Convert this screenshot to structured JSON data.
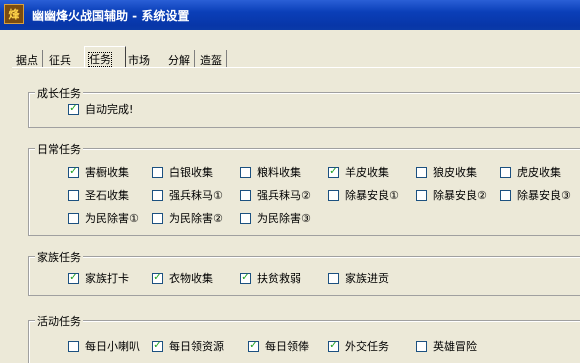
{
  "window": {
    "title": "幽幽烽火战国辅助  -  系统设置",
    "icon_glyph": "烽"
  },
  "tabs": [
    "据点",
    "征兵",
    "任务",
    "市场",
    "分解",
    "造盔"
  ],
  "groups": {
    "growth": {
      "title": "成长任务",
      "items": [
        {
          "label": "自动完成!",
          "checked": true
        }
      ]
    },
    "daily": {
      "title": "日常任务",
      "items": [
        {
          "label": "害橱收集",
          "checked": true
        },
        {
          "label": "白银收集",
          "checked": false
        },
        {
          "label": "粮料收集",
          "checked": false
        },
        {
          "label": "羊皮收集",
          "checked": true
        },
        {
          "label": "狼皮收集",
          "checked": false
        },
        {
          "label": "虎皮收集",
          "checked": false
        },
        {
          "label": "圣石收集",
          "checked": false
        },
        {
          "label": "强兵秣马①",
          "checked": false
        },
        {
          "label": "强兵秣马②",
          "checked": false
        },
        {
          "label": "除暴安良①",
          "checked": false
        },
        {
          "label": "除暴安良②",
          "checked": false
        },
        {
          "label": "除暴安良③",
          "checked": false
        },
        {
          "label": "为民除害①",
          "checked": false
        },
        {
          "label": "为民除害②",
          "checked": false
        },
        {
          "label": "为民除害③",
          "checked": false
        }
      ]
    },
    "family": {
      "title": "家族任务",
      "items": [
        {
          "label": "家族打卡",
          "checked": true
        },
        {
          "label": "衣物收集",
          "checked": true
        },
        {
          "label": "扶贫救弱",
          "checked": true
        },
        {
          "label": "家族进贡",
          "checked": false
        }
      ]
    },
    "activity": {
      "title": "活动任务",
      "items": [
        {
          "label": "每日小喇叭",
          "checked": false
        },
        {
          "label": "每日领资源",
          "checked": true
        },
        {
          "label": "每日领俸",
          "checked": true
        },
        {
          "label": "外交任务",
          "checked": true
        },
        {
          "label": "英雄冒险",
          "checked": false
        }
      ]
    }
  },
  "colors": {
    "titlebar": "#0a3fb8",
    "check": "#21a121",
    "face": "#ece9d8"
  }
}
